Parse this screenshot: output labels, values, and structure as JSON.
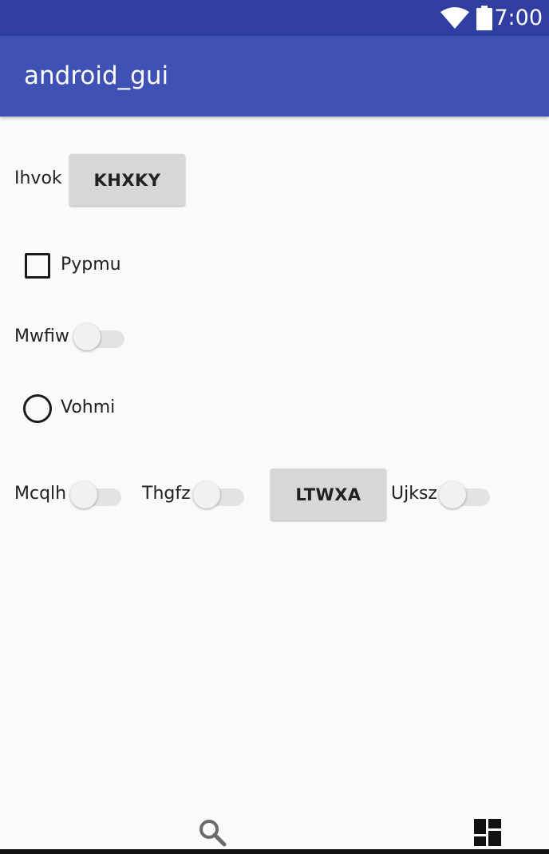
{
  "status_bar": {
    "time": "7:00",
    "icons": [
      "wifi-icon",
      "battery-icon"
    ]
  },
  "app_bar": {
    "title": "android_gui"
  },
  "row1": {
    "label": "Ihvok",
    "button": "KHXKY"
  },
  "checkbox": {
    "label": "Pypmu",
    "checked": false
  },
  "switch1": {
    "label": "Mwfiw",
    "on": false
  },
  "radio": {
    "label": "Vohmi",
    "selected": false
  },
  "row5": {
    "switch_a": {
      "label": "Mcqlh",
      "on": false
    },
    "switch_b": {
      "label": "Thgfz",
      "on": false
    },
    "button": "LTWXA",
    "switch_c": {
      "label": "Ujksz",
      "on": false
    }
  },
  "bottom_bar": {
    "icons": [
      "search-icon",
      "dashboard-icon"
    ]
  },
  "colors": {
    "status_bar": "#2f3ea0",
    "app_bar": "#3f51b5",
    "background": "#fafafa",
    "button": "#d6d7d7"
  }
}
